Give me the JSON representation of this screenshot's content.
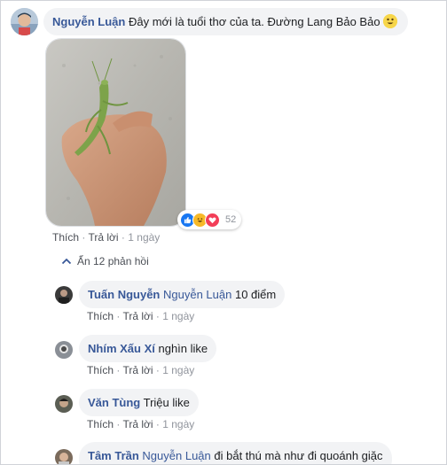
{
  "main_comment": {
    "author": "Nguyễn Luận",
    "text": "Đây mới là tuổi thơ của ta. Đường Lang Bảo Bảo",
    "reaction_count": "52",
    "actions": {
      "like": "Thích",
      "separator": "·",
      "reply": "Trả lời",
      "time": "1 ngày"
    }
  },
  "hide_replies": "Ẩn 12 phản hồi",
  "replies": [
    {
      "author": "Tuấn Nguyễn",
      "mention": "Nguyễn Luận",
      "text": "10 điểm",
      "like": "Thích",
      "reply": "Trả lời",
      "time": "1 ngày"
    },
    {
      "author": "Nhím Xấu Xí",
      "mention": "",
      "text": "nghìn like",
      "like": "Thích",
      "reply": "Trả lời",
      "time": "1 ngày"
    },
    {
      "author": "Văn Tùng",
      "mention": "",
      "text": "Triệu like",
      "like": "Thích",
      "reply": "Trả lời",
      "time": "1 ngày"
    },
    {
      "author": "Tâm Trần",
      "mention": "Nguyễn Luận",
      "text": "đi bắt thú mà như đi quoánh giặc"
    }
  ],
  "colors": {
    "link": "#385898",
    "bubble": "#f2f3f5",
    "muted": "#90949c",
    "like_blue": "#1877f2",
    "love_red": "#f33e58",
    "haha_yellow": "#f7b928"
  },
  "icons": {
    "haha": "haha-emoji-icon",
    "like": "like-reaction-icon",
    "love": "love-reaction-icon",
    "chevron": "chevron-up-icon"
  }
}
